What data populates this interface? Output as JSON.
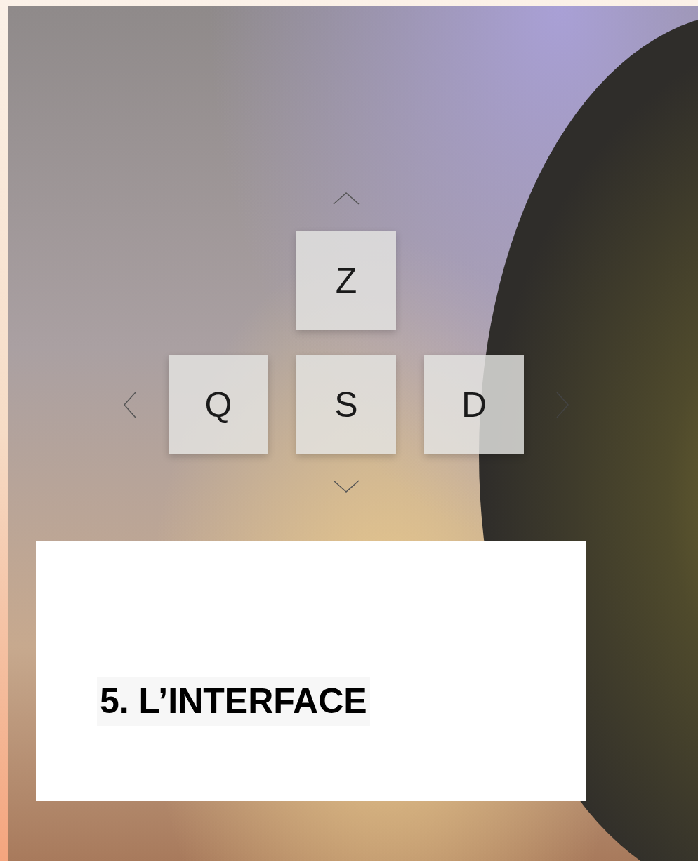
{
  "keypad": {
    "rows": [
      [
        null,
        {
          "label": "Z"
        },
        null
      ],
      [
        {
          "label": "Q"
        },
        {
          "label": "S"
        },
        {
          "label": "D"
        }
      ]
    ]
  },
  "card": {
    "title": "5. L’INTERFACE"
  }
}
